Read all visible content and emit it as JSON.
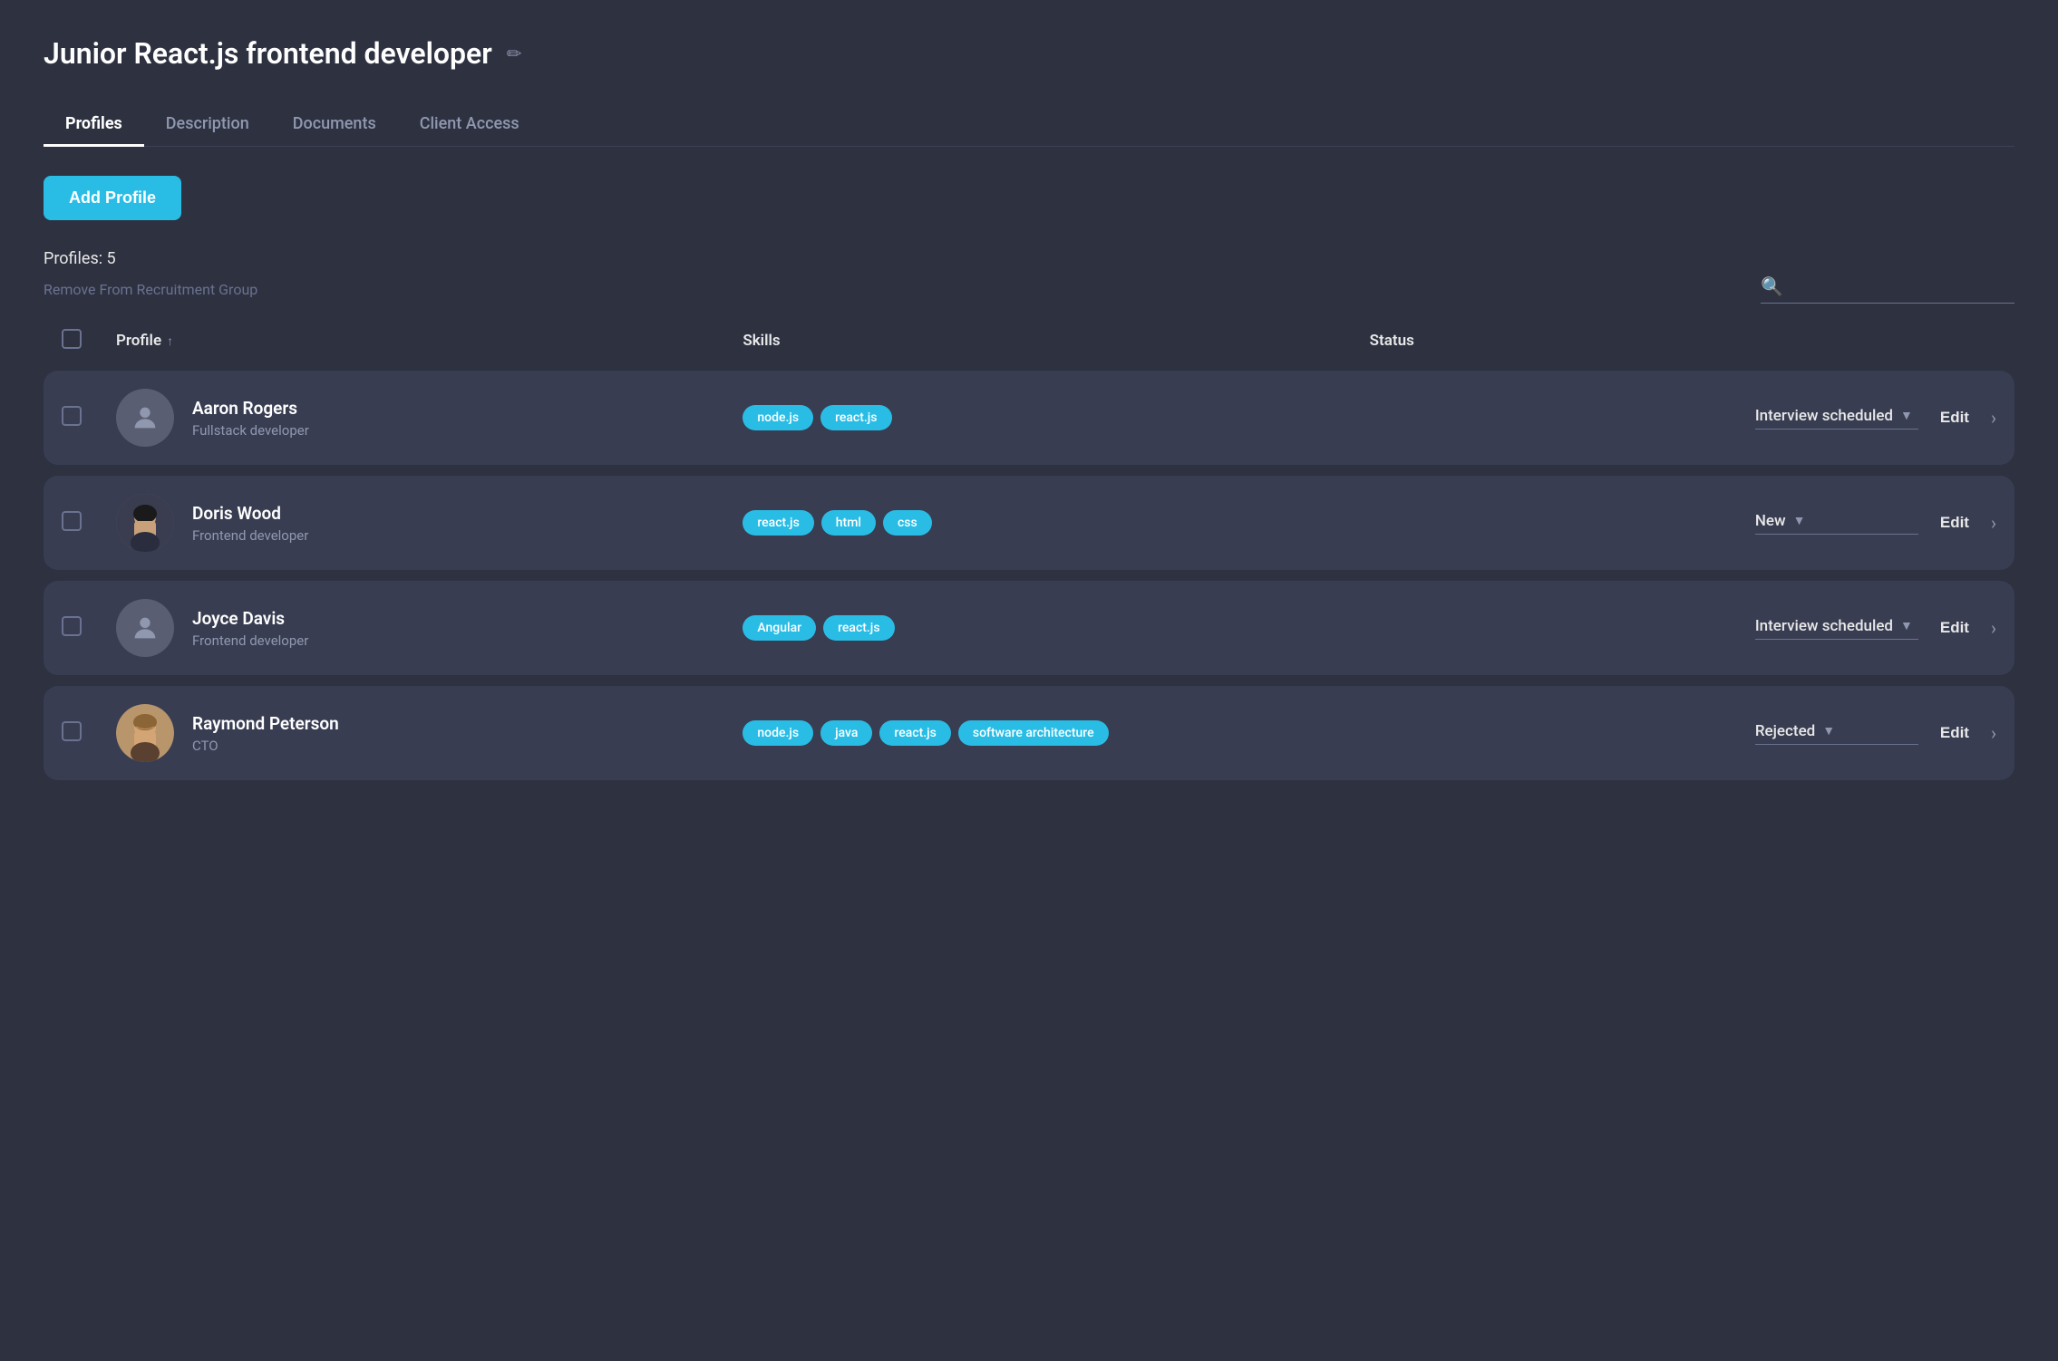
{
  "page": {
    "title": "Junior React.js frontend developer",
    "edit_icon": "✏"
  },
  "tabs": [
    {
      "id": "profiles",
      "label": "Profiles",
      "active": true
    },
    {
      "id": "description",
      "label": "Description",
      "active": false
    },
    {
      "id": "documents",
      "label": "Documents",
      "active": false
    },
    {
      "id": "client-access",
      "label": "Client Access",
      "active": false
    }
  ],
  "add_profile_button": "Add Profile",
  "profiles_count": "Profiles: 5",
  "remove_group_text": "Remove From Recruitment Group",
  "search_placeholder": "",
  "table_headers": {
    "profile": "Profile",
    "skills": "Skills",
    "status": "Status"
  },
  "profiles": [
    {
      "id": 1,
      "name": "Aaron Rogers",
      "role": "Fullstack developer",
      "avatar_type": "placeholder",
      "skills": [
        "node.js",
        "react.js"
      ],
      "status": "Interview scheduled"
    },
    {
      "id": 2,
      "name": "Doris Wood",
      "role": "Frontend developer",
      "avatar_type": "photo_doris",
      "skills": [
        "react.js",
        "html",
        "css"
      ],
      "status": "New"
    },
    {
      "id": 3,
      "name": "Joyce Davis",
      "role": "Frontend developer",
      "avatar_type": "placeholder",
      "skills": [
        "Angular",
        "react.js"
      ],
      "status": "Interview scheduled"
    },
    {
      "id": 4,
      "name": "Raymond Peterson",
      "role": "CTO",
      "avatar_type": "photo_raymond",
      "skills": [
        "node.js",
        "java",
        "react.js",
        "software architecture"
      ],
      "status": "Rejected"
    }
  ],
  "labels": {
    "edit": "Edit"
  },
  "colors": {
    "accent": "#29bde6",
    "background": "#2d3140",
    "card": "#383d52"
  }
}
